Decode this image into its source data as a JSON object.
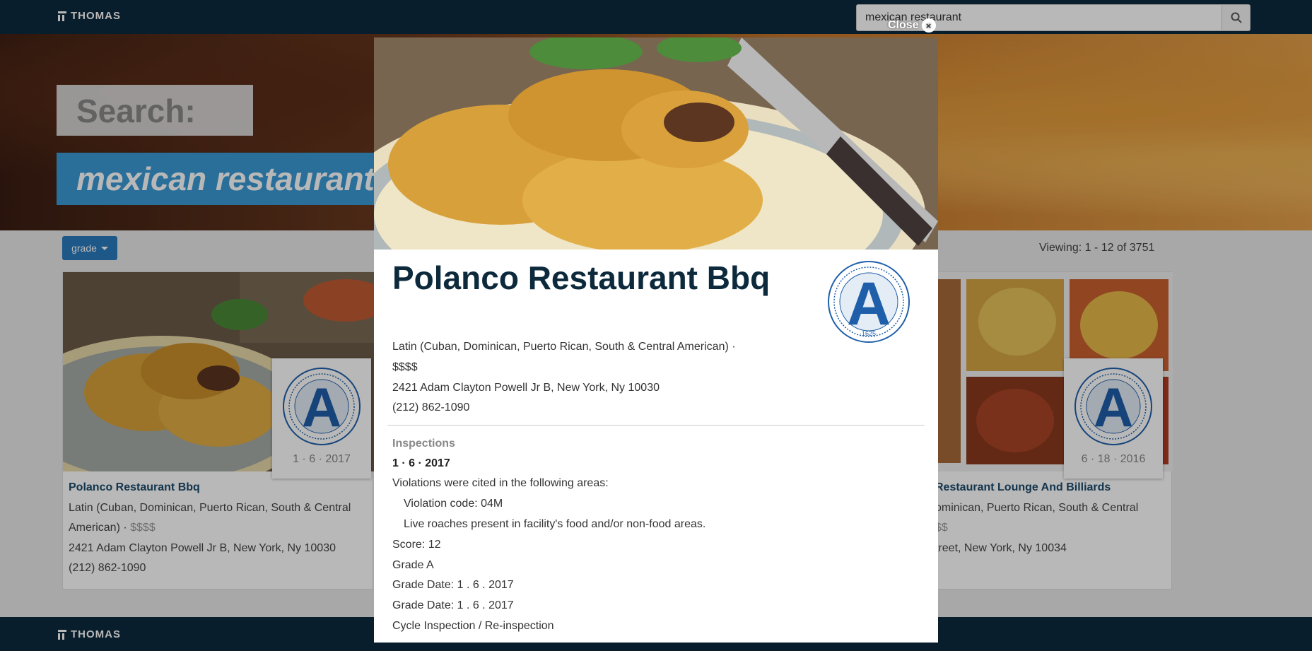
{
  "header": {
    "brand": "THOMAS",
    "search_value": "mexican restaurant"
  },
  "hero": {
    "search_label": "Search:",
    "query": "mexican restaurant"
  },
  "filter": {
    "grade_label": "grade"
  },
  "viewing": "Viewing: 1 - 12 of 3751",
  "cards": [
    {
      "badge_date": "1 · 6 · 2017",
      "name": "Polanco Restaurant Bbq",
      "cuisine": "Latin (Cuban, Dominican, Puerto Rican, South & Central",
      "cuisine2": "American) · ",
      "price": "$$$$",
      "address": "2421 Adam Clayton Powell Jr B, New York, Ny 10030",
      "phone": "(212) 862-1090"
    },
    {
      "badge_date": "6 · 18 · 2016",
      "name": "Restaurant Lounge And Billiards",
      "cuisine": "ominican, Puerto Rican, South & Central",
      "price": "$$",
      "address": "treet, New York, Ny 10034"
    }
  ],
  "modal": {
    "close_label": "Close",
    "close_icon": "×",
    "title": "Polanco Restaurant Bbq",
    "cuisine": "Latin (Cuban, Dominican, Puerto Rican, South & Central American) ·",
    "price": "$$$$",
    "address": "2421 Adam Clayton Powell Jr B, New York, Ny 10030",
    "phone": "(212) 862-1090",
    "inspections_label": "Inspections",
    "inspection_date": "1 · 6 · 2017",
    "violations_intro": "Violations were cited in the following areas:",
    "violation_code": "Violation code: 04M",
    "violation_desc": "Live roaches present in facility's food and/or non-food areas.",
    "score": "Score: 12",
    "grade": "Grade A",
    "grade_date_1": "Grade Date: 1 . 6 . 2017",
    "grade_date_2": "Grade Date: 1 . 6 . 2017",
    "inspection_type": "Cycle Inspection / Re-inspection"
  },
  "seal": {
    "letter": "A",
    "year": "·1625·"
  },
  "colors": {
    "navy": "#0d2a3d",
    "accent": "#2a7bbd",
    "seal_blue": "#1f5faa"
  }
}
